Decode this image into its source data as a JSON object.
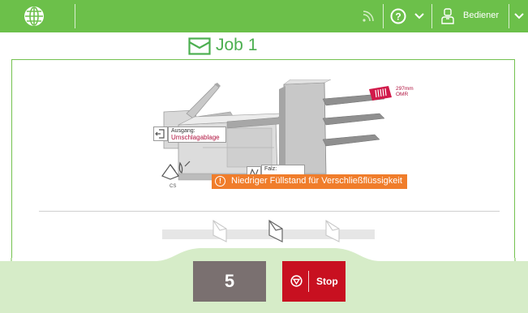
{
  "colors": {
    "brand_green": "#6cc04a",
    "warning_orange": "#f07d2b",
    "stop_red": "#c81020",
    "label_red": "#b0123e"
  },
  "topbar": {
    "icons": [
      "globe-icon",
      "rss-icon",
      "help-icon",
      "chevron-down-icon",
      "user-icon",
      "chevron-down-icon"
    ],
    "user_label": "Bediener"
  },
  "job": {
    "title": "Job 1",
    "icon": "envelope-icon"
  },
  "machine": {
    "output_label": "Ausgang:",
    "output_value": "Umschlagablage",
    "fold_label": "Falz:",
    "sheet_size": "297mm",
    "sheet_mark": "OMR",
    "cs_label": "CS"
  },
  "warning": {
    "text": "Niedriger Füllstand für Verschließflüssigkeit",
    "icon": "warning-icon"
  },
  "counter": {
    "value": "5"
  },
  "stop_button": {
    "label": "Stop",
    "icon": "stop-icon"
  }
}
